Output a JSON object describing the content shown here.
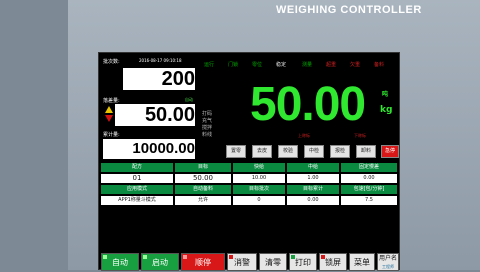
{
  "brand": "WEIGHING CONTROLLER",
  "left_panel": {
    "batch_label": "批次数:",
    "batch_value": "200",
    "datetime": "2016-08-17   09:10:18",
    "drop_label": "落差量:",
    "drop_value": "50.00",
    "auto_label": "自动",
    "total_label": "累计量:",
    "total_value": "10000.00"
  },
  "status": [
    "运行",
    "门锁",
    "零位",
    "稳定",
    "测量",
    "超重",
    "欠重",
    "备料"
  ],
  "modes": [
    "打码",
    "充气",
    "搅拌",
    "料线"
  ],
  "weight": "50.00",
  "unit_top": "吨",
  "unit": "kg",
  "limit_upper": "上称标",
  "limit_lower": "下称标",
  "func_keys": [
    "置零",
    "去皮",
    "校验",
    "中检",
    "报检",
    "卸料",
    "急停"
  ],
  "table": {
    "headers1": [
      "配方",
      "目标",
      "快给",
      "中给",
      "固定慢差"
    ],
    "row1": [
      "01",
      "50.00",
      "10.00",
      "1.00",
      "0.00"
    ],
    "headers2": [
      "应用模式",
      "自动备料",
      "目标批次",
      "目标累计",
      "包速[包/分钟]"
    ],
    "row2": [
      "APP1称量斗模式",
      "允许",
      "0",
      "0.00",
      "7.5"
    ]
  },
  "buttons": [
    "自动",
    "启动",
    "顺停",
    "消警",
    "清零",
    "打印",
    "锁屏",
    "菜单"
  ],
  "user": {
    "label": "用户名",
    "name": "工程师"
  },
  "colors": {
    "accent_green": "#2fe82f",
    "header_green": "#0a8a40",
    "alert_red": "#d81818"
  }
}
